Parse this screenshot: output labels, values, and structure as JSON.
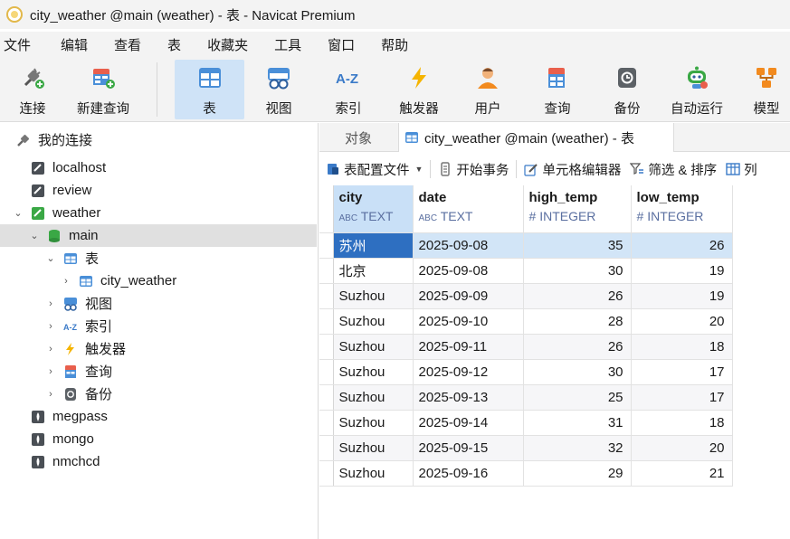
{
  "window": {
    "title": "city_weather @main (weather) - 表 - Navicat Premium"
  },
  "menu": [
    "文件",
    "编辑",
    "查看",
    "表",
    "收藏夹",
    "工具",
    "窗口",
    "帮助"
  ],
  "toolbar": {
    "connect": "连接",
    "new_query": "新建查询",
    "table": "表",
    "view": "视图",
    "index": "索引",
    "trigger": "触发器",
    "user": "用户",
    "query": "查询",
    "backup": "备份",
    "automation": "自动运行",
    "model": "模型"
  },
  "nav": {
    "header": "我的连接",
    "items": [
      {
        "label": "localhost"
      },
      {
        "label": "review"
      },
      {
        "label": "weather"
      },
      {
        "label": "main"
      },
      {
        "label": "表"
      },
      {
        "label": "city_weather"
      },
      {
        "label": "视图"
      },
      {
        "label": "索引"
      },
      {
        "label": "触发器"
      },
      {
        "label": "查询"
      },
      {
        "label": "备份"
      },
      {
        "label": "megpass"
      },
      {
        "label": "mongo"
      },
      {
        "label": "nmchcd"
      }
    ]
  },
  "tabs": {
    "objects": "对象",
    "active": "city_weather @main (weather) - 表"
  },
  "datatoolbar": {
    "profile": "表配置文件",
    "begin_tx": "开始事务",
    "cell_editor": "单元格编辑器",
    "filter_sort": "筛选 & 排序",
    "columns": "列"
  },
  "grid": {
    "columns": [
      {
        "name": "city",
        "type": "TEXT"
      },
      {
        "name": "date",
        "type": "TEXT"
      },
      {
        "name": "high_temp",
        "type": "INTEGER"
      },
      {
        "name": "low_temp",
        "type": "INTEGER"
      }
    ],
    "rows": [
      [
        "苏州",
        "2025-09-08",
        "35",
        "26"
      ],
      [
        "北京",
        "2025-09-08",
        "30",
        "19"
      ],
      [
        "Suzhou",
        "2025-09-09",
        "26",
        "19"
      ],
      [
        "Suzhou",
        "2025-09-10",
        "28",
        "20"
      ],
      [
        "Suzhou",
        "2025-09-11",
        "26",
        "18"
      ],
      [
        "Suzhou",
        "2025-09-12",
        "30",
        "17"
      ],
      [
        "Suzhou",
        "2025-09-13",
        "25",
        "17"
      ],
      [
        "Suzhou",
        "2025-09-14",
        "31",
        "18"
      ],
      [
        "Suzhou",
        "2025-09-15",
        "32",
        "20"
      ],
      [
        "Suzhou",
        "2025-09-16",
        "29",
        "21"
      ]
    ]
  },
  "colors": {
    "accent": "#2e6fc1",
    "selection": "#d2e5f7",
    "active_tool": "#cfe3f7"
  }
}
